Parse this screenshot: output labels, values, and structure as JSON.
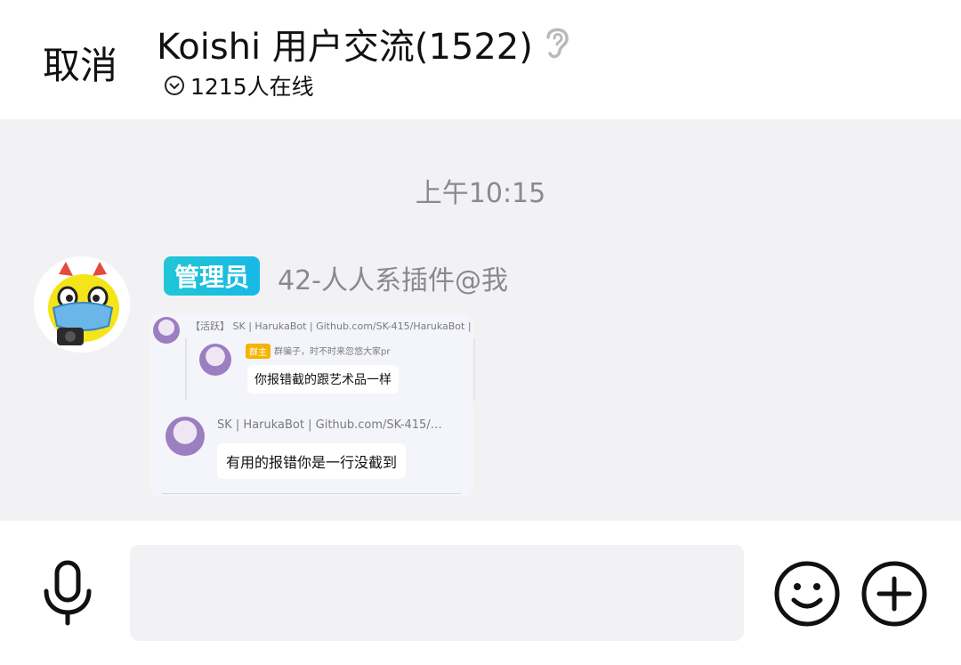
{
  "header": {
    "cancel_label": "取消",
    "title": "Koishi 用户交流(1522)",
    "online_text": "1215人在线"
  },
  "chat": {
    "timestamp": "上午10:15",
    "message": {
      "role_badge": "管理员",
      "sender": "42-人人系插件@我",
      "quoted": {
        "line1": "【活跃】 SK | HarukaBot | Github.com/SK-415/HarukaBot |",
        "admin_tag": "群主",
        "subtext": "群骗子，时不时来忽悠大家pr",
        "bubble1": "你报错截的跟艺术品一样",
        "line2": "SK | HarukaBot | Github.com/SK-415/…",
        "bubble2": "有用的报错你是一行没截到"
      }
    }
  },
  "input": {
    "placeholder": "",
    "value": ""
  },
  "colors": {
    "badge_gradient": [
      "#21c6d6",
      "#17b9e6"
    ],
    "muted_text": "#8a8a8e",
    "background": "#f2f2f4"
  },
  "icons": {
    "voice": "ear-icon",
    "online_indicator": "chevron-down-circle-icon",
    "mic": "microphone-icon",
    "emoji": "smiley-icon",
    "add": "plus-circle-icon"
  }
}
